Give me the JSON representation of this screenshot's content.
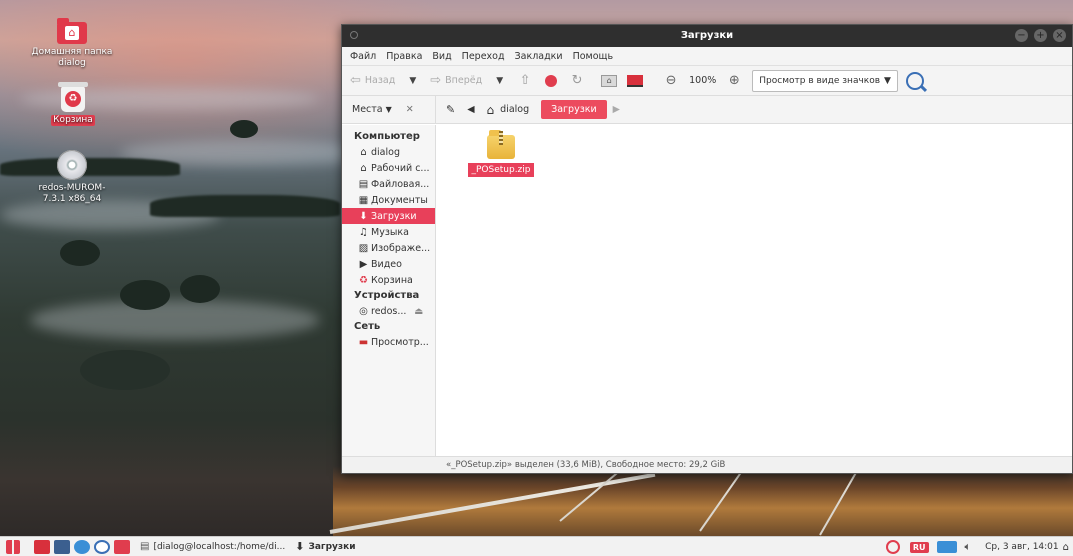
{
  "desktop": {
    "icons": [
      {
        "label": "Домашняя папка dialog",
        "icon": "home-folder-icon"
      },
      {
        "label": "Корзина",
        "icon": "trash-icon"
      },
      {
        "label": "redos-MUROM-7.3.1 x86_64",
        "icon": "optical-disc-icon"
      }
    ]
  },
  "window": {
    "title": "Загрузки",
    "menu": [
      "Файл",
      "Правка",
      "Вид",
      "Переход",
      "Закладки",
      "Помощь"
    ],
    "toolbar": {
      "back_label": "Назад",
      "forward_label": "Вперёд",
      "zoom": "100%",
      "view_mode": "Просмотр в виде значков"
    },
    "location": {
      "places_label": "Места",
      "crumbs": [
        "dialog",
        "Загрузки"
      ]
    },
    "sidebar": {
      "sections": [
        {
          "title": "Компьютер",
          "items": [
            {
              "label": "dialog",
              "icon": "home-icon"
            },
            {
              "label": "Рабочий с...",
              "icon": "desktop-icon"
            },
            {
              "label": "Файловая...",
              "icon": "filesystem-icon"
            },
            {
              "label": "Документы",
              "icon": "documents-icon"
            },
            {
              "label": "Загрузки",
              "icon": "downloads-icon",
              "active": true
            },
            {
              "label": "Музыка",
              "icon": "music-icon"
            },
            {
              "label": "Изображе...",
              "icon": "pictures-icon"
            },
            {
              "label": "Видео",
              "icon": "video-icon"
            },
            {
              "label": "Корзина",
              "icon": "trash-icon"
            }
          ]
        },
        {
          "title": "Устройства",
          "items": [
            {
              "label": "redos...",
              "icon": "disc-icon"
            }
          ]
        },
        {
          "title": "Сеть",
          "items": [
            {
              "label": "Просмотр...",
              "icon": "network-icon"
            }
          ]
        }
      ]
    },
    "files": [
      {
        "name": "_POSetup.zip",
        "icon": "zip-archive-icon",
        "selected": true
      }
    ],
    "status": "«_POSetup.zip» выделен (33,6 MiB), Свободное место: 29,2 GiB"
  },
  "taskbar": {
    "tasks": [
      {
        "label": "[dialog@localhost:/home/di...",
        "icon": "terminal-icon"
      },
      {
        "label": "Загрузки",
        "icon": "downloads-icon"
      }
    ],
    "lang": "RU",
    "clock": "Ср, 3 авг, 14:01"
  },
  "colors": {
    "accent": "#e8405a",
    "titlebar": "#2f2f2f"
  }
}
